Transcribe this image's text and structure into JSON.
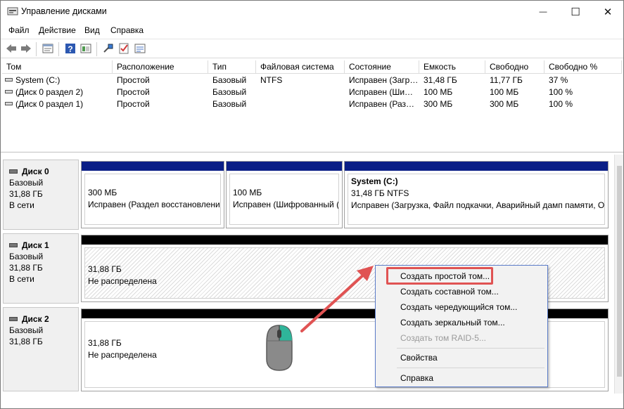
{
  "window": {
    "title": "Управление дисками",
    "minimize_glyph": "—",
    "maximize_glyph": "☐",
    "close_glyph": "✕"
  },
  "menu": [
    "Файл",
    "Действие",
    "Вид",
    "Справка"
  ],
  "toolbar": {
    "icons": [
      "back-icon",
      "forward-icon",
      "properties-icon",
      "help-icon",
      "console-icon",
      "connect-icon",
      "check-icon",
      "list-icon"
    ]
  },
  "volume_table": {
    "headers": [
      "Том",
      "Расположение",
      "Тип",
      "Файловая система",
      "Состояние",
      "Емкость",
      "Свободно",
      "Свободно %"
    ],
    "rows": [
      [
        "System (C:)",
        "Простой",
        "Базовый",
        "NTFS",
        "Исправен (Загр…",
        "31,48 ГБ",
        "11,77 ГБ",
        "37 %"
      ],
      [
        "(Диск 0 раздел 2)",
        "Простой",
        "Базовый",
        "",
        "Исправен (Ши…",
        "100 МБ",
        "100 МБ",
        "100 %"
      ],
      [
        "(Диск 0 раздел 1)",
        "Простой",
        "Базовый",
        "",
        "Исправен (Раз…",
        "300 МБ",
        "300 МБ",
        "100 %"
      ]
    ]
  },
  "disks": [
    {
      "name": "Диск 0",
      "type": "Базовый",
      "size": "31,88 ГБ",
      "status": "В сети",
      "partitions": [
        {
          "title": "",
          "line1": "300 МБ",
          "line2": "Исправен (Раздел восстановления"
        },
        {
          "title": "",
          "line1": "100 МБ",
          "line2": "Исправен (Шифрованный ("
        },
        {
          "title": "System  (C:)",
          "line1": "31,48 ГБ NTFS",
          "line2": "Исправен (Загрузка, Файл подкачки, Аварийный дамп памяти, Ос"
        }
      ]
    },
    {
      "name": "Диск 1",
      "type": "Базовый",
      "size": "31,88 ГБ",
      "status": "В сети",
      "partitions": [
        {
          "title": "",
          "line1": "31,88 ГБ",
          "line2": "Не распределена"
        }
      ]
    },
    {
      "name": "Диск 2",
      "type": "Базовый",
      "size": "31,88 ГБ",
      "status": "",
      "partitions": [
        {
          "title": "",
          "line1": "31,88 ГБ",
          "line2": "Не распределена"
        }
      ]
    }
  ],
  "context_menu": {
    "items": [
      {
        "label": "Создать простой том...",
        "enabled": true,
        "highlighted": true
      },
      {
        "label": "Создать составной том...",
        "enabled": true
      },
      {
        "label": "Создать чередующийся том...",
        "enabled": true
      },
      {
        "label": "Создать зеркальный том...",
        "enabled": true
      },
      {
        "label": "Создать том RAID-5...",
        "enabled": false
      },
      {
        "label": "Свойства",
        "enabled": true
      },
      {
        "label": "Справка",
        "enabled": true
      }
    ]
  },
  "colors": {
    "primary_partition_bar": "#0a1e86",
    "unallocated_bar": "#000000",
    "annotation_red": "#e05353",
    "mouse_accent": "#2fb59a"
  }
}
